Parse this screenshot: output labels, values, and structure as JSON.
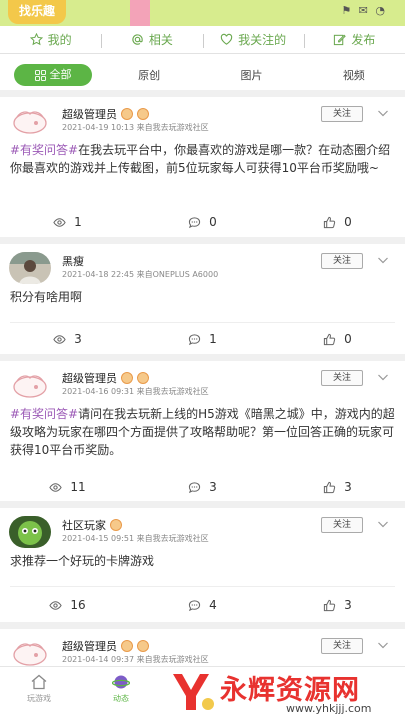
{
  "banner": {
    "logo_text": "找乐趣"
  },
  "top_tabs": [
    {
      "label": "我的",
      "icon": "star-icon"
    },
    {
      "label": "相关",
      "icon": "at-icon"
    },
    {
      "label": "我关注的",
      "icon": "heart-icon"
    },
    {
      "label": "发布",
      "icon": "edit-icon"
    }
  ],
  "filters": {
    "all": "全部",
    "original": "原创",
    "images": "图片",
    "videos": "视频"
  },
  "posts": [
    {
      "author": "超级管理员",
      "meta": "2021-04-19 10:13 来自我去玩游戏社区",
      "follow": "关注",
      "hashtag": "#有奖问答#",
      "text": "在我去玩平台中，你最喜欢的游戏是哪一款？在动态圈介绍你最喜欢的游戏并上传截图，前5位玩家每人可获得10平台币奖励哦~",
      "views": "1",
      "comments": "0",
      "likes": "0"
    },
    {
      "author": "黑瘦",
      "meta": "2021-04-18 22:45 来自ONEPLUS A6000",
      "follow": "关注",
      "hashtag": "",
      "text": "积分有啥用啊",
      "views": "3",
      "comments": "1",
      "likes": "0"
    },
    {
      "author": "超级管理员",
      "meta": "2021-04-16 09:31 来自我去玩游戏社区",
      "follow": "关注",
      "hashtag": "#有奖问答#",
      "text": "请问在我去玩新上线的H5游戏《暗黑之城》中，游戏内的超级攻略为玩家在哪四个方面提供了攻略帮助呢？第一位回答正确的玩家可获得10平台币奖励。",
      "views": "11",
      "comments": "3",
      "likes": "3"
    },
    {
      "author": "社区玩家",
      "meta": "2021-04-15 09:51 来自我去玩游戏社区",
      "follow": "关注",
      "hashtag": "",
      "text": "求推荐一个好玩的卡牌游戏",
      "views": "16",
      "comments": "4",
      "likes": "3"
    },
    {
      "author": "超级管理员",
      "meta": "2021-04-14 09:37 来自我去玩游戏社区",
      "follow": "关注"
    }
  ],
  "bottom_nav": {
    "games": "玩游戏",
    "feed": "动态"
  },
  "watermark": {
    "text": "永辉资源网",
    "url": "www.yhkjjj.com"
  },
  "colors": {
    "accent": "#5cb545",
    "hashtag": "#9b59b6",
    "watermark": "#e8322f"
  }
}
